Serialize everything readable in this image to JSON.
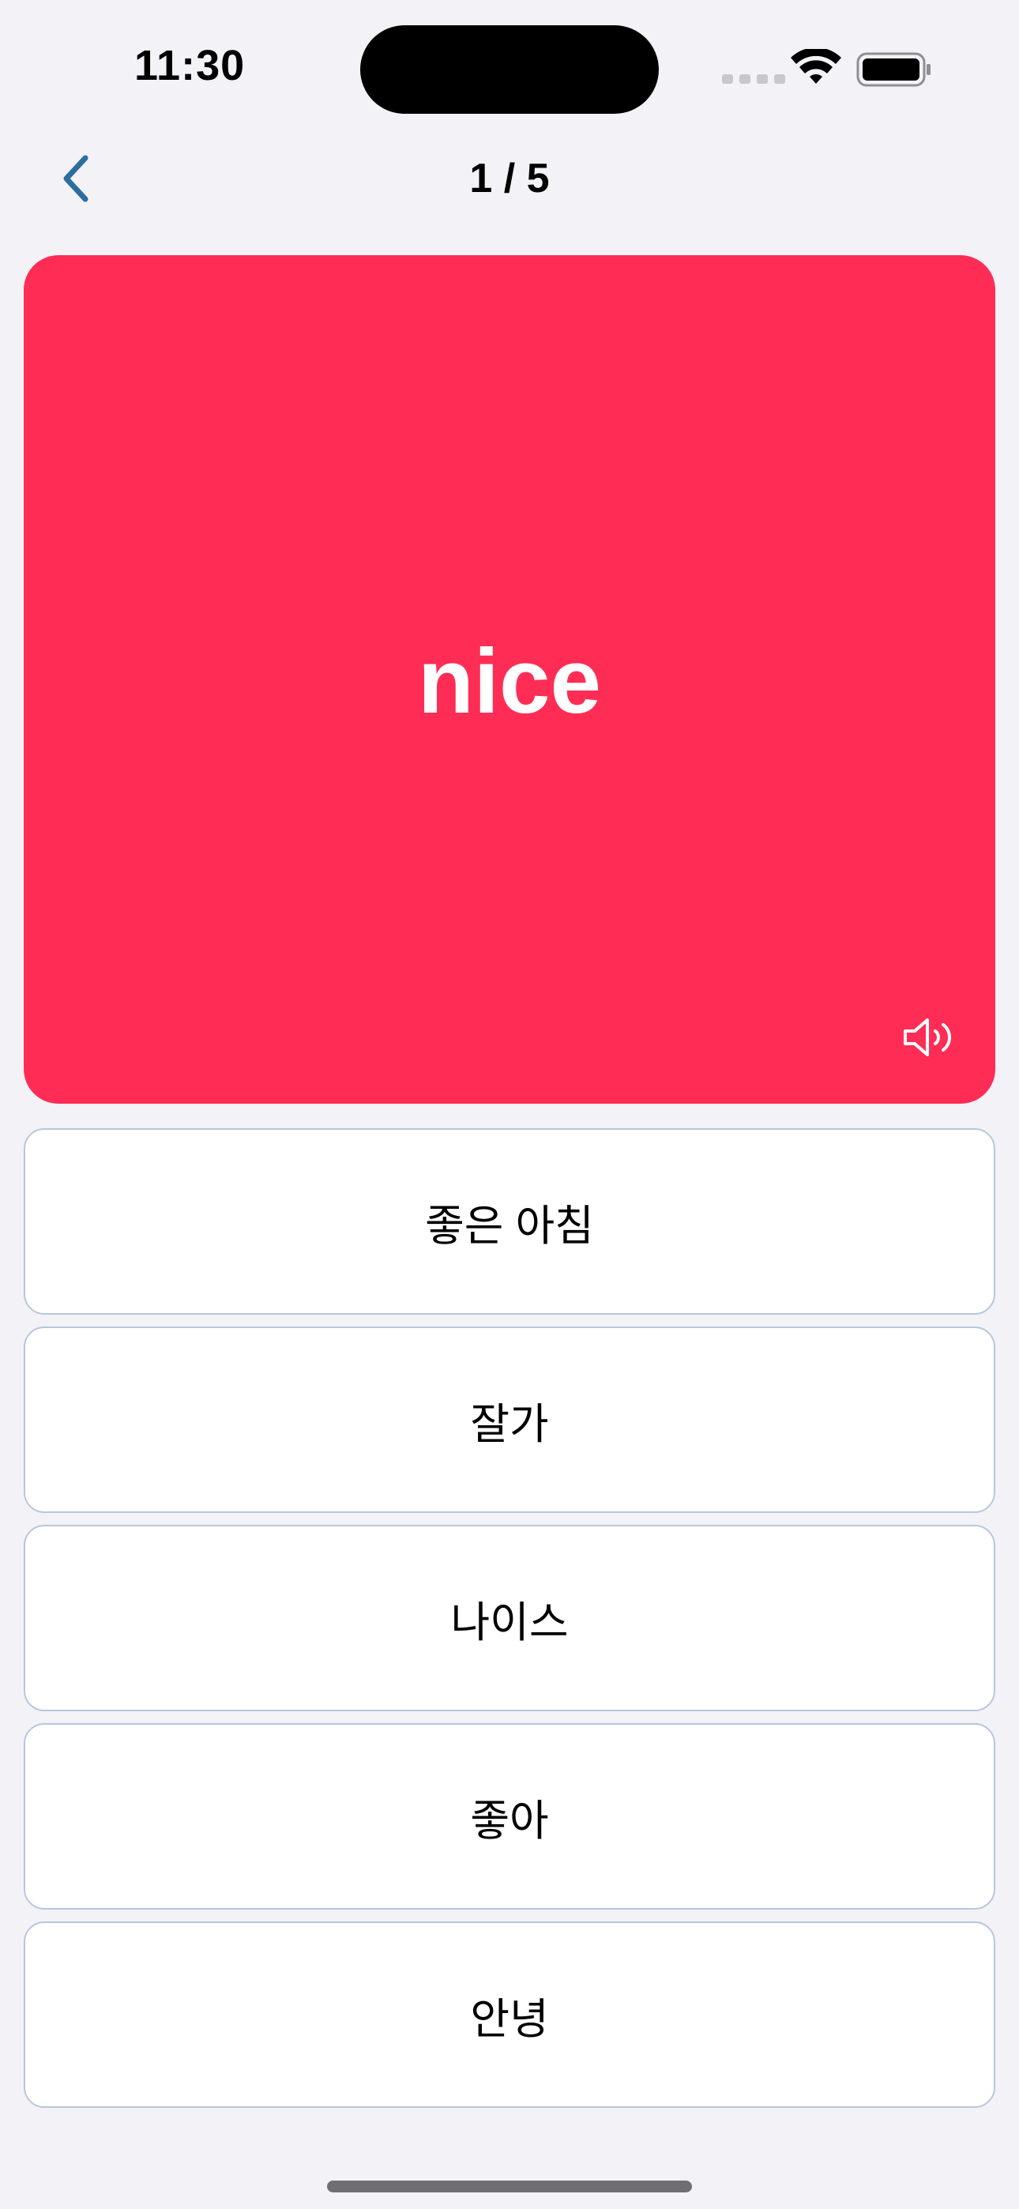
{
  "status_bar": {
    "time": "11:30"
  },
  "nav": {
    "progress": "1 / 5",
    "back_icon": "chevron-left-icon"
  },
  "card": {
    "word": "nice",
    "background_color": "#ff2d55",
    "speaker_icon": "speaker-icon"
  },
  "options": [
    {
      "label": "좋은 아침"
    },
    {
      "label": "잘가"
    },
    {
      "label": "나이스"
    },
    {
      "label": "좋아"
    },
    {
      "label": "안녕"
    }
  ],
  "colors": {
    "accent": "#2c6e9e",
    "card": "#ff2d55",
    "background": "#f2f2f7",
    "option_border": "#b8c7db"
  }
}
